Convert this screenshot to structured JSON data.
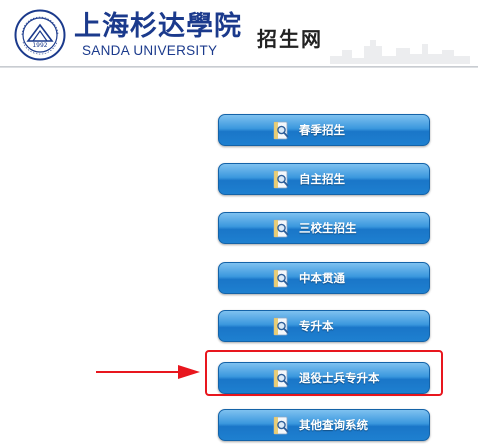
{
  "header": {
    "logo_cn": "上海杉达學院",
    "logo_en": "SANDA UNIVERSITY",
    "site_title": "招生网",
    "seal_text": "1992",
    "seal_icon": "university-seal-icon"
  },
  "menu": {
    "items": [
      {
        "label": "春季招生"
      },
      {
        "label": "自主招生"
      },
      {
        "label": "三校生招生"
      },
      {
        "label": "中本贯通"
      },
      {
        "label": "专升本"
      },
      {
        "label": "退役士兵专升本"
      },
      {
        "label": "其他查询系统"
      }
    ],
    "highlighted_index": 5,
    "button_icon": "magnifier-document-icon"
  },
  "colors": {
    "brand_blue": "#1b3a8c",
    "button_blue": "#1a76c8",
    "highlight_red": "#e8161e"
  }
}
